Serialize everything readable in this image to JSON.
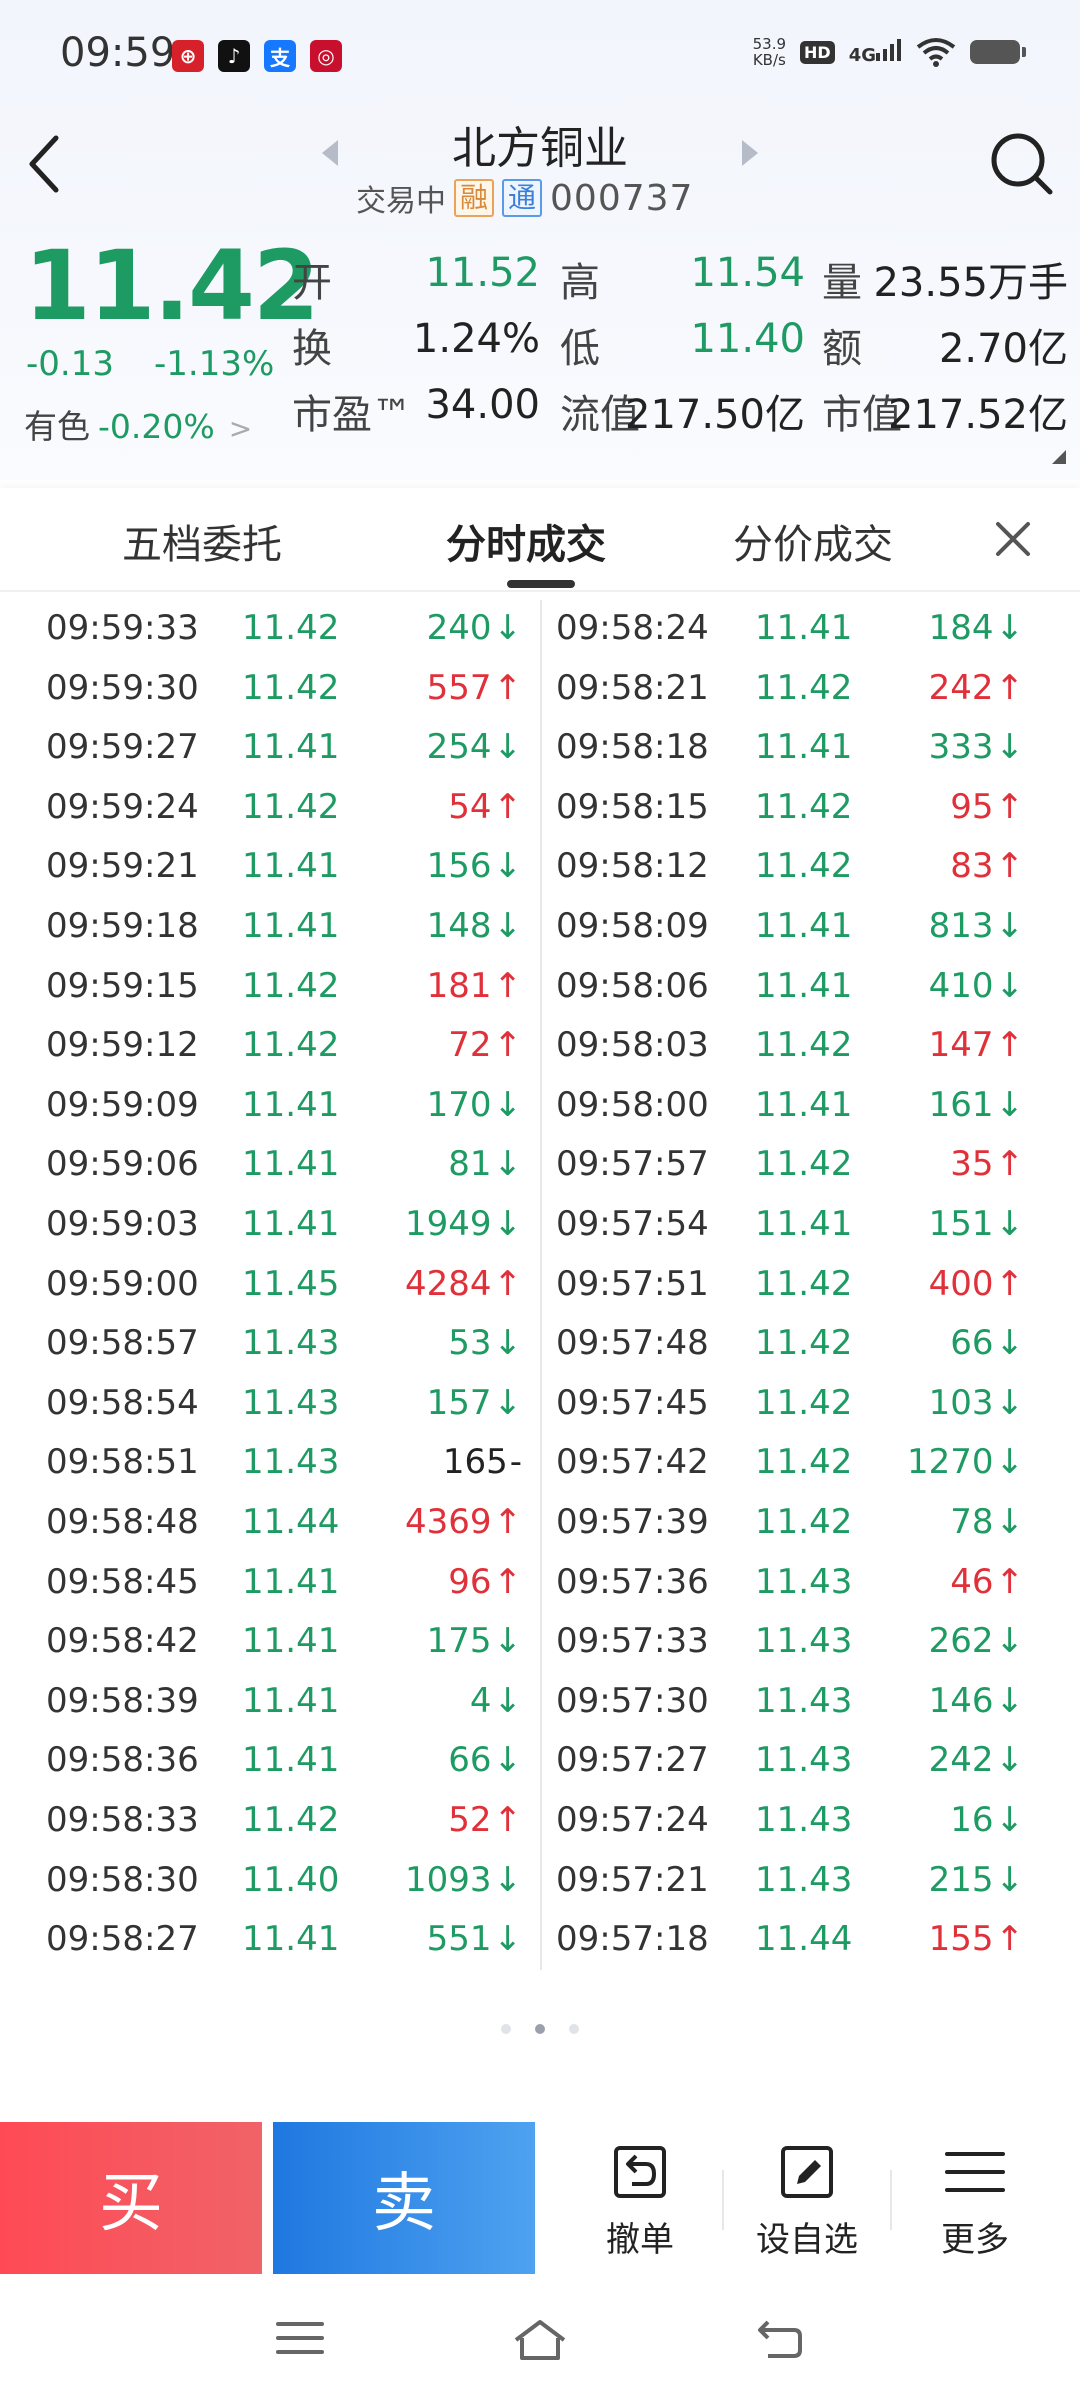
{
  "status_bar": {
    "time": "09:59",
    "net_speed_value": "53.9",
    "net_speed_unit": "KB/s",
    "hd": "HD",
    "network": "4G",
    "apps": [
      {
        "name": "bank-app-icon",
        "glyph": "⊕",
        "color": "#d6212b"
      },
      {
        "name": "tiktok-app-icon",
        "glyph": "♪",
        "color": "#111111"
      },
      {
        "name": "alipay-app-icon",
        "glyph": "支",
        "color": "#1677ff"
      },
      {
        "name": "china-bank-app-icon",
        "glyph": "◎",
        "color": "#c8102e"
      }
    ]
  },
  "header": {
    "title": "北方铜业",
    "status": "交易中",
    "tag_rong": "融",
    "tag_tong": "通",
    "code": "000737"
  },
  "quote": {
    "price": "11.42",
    "change": "-0.13",
    "change_pct": "-1.13%",
    "sector_label": "有色",
    "sector_change": "-0.20%",
    "sector_arrow": ">",
    "open_label": "开",
    "open": "11.52",
    "high_label": "高",
    "high": "11.54",
    "volume_label": "量",
    "volume": "23.55万手",
    "turnover_label": "换",
    "turnover": "1.24%",
    "low_label": "低",
    "low": "11.40",
    "amount_label": "额",
    "amount": "2.70亿",
    "pe_label": "市盈™",
    "pe": "34.00",
    "float_cap_label": "流值",
    "float_cap": "217.50亿",
    "total_cap_label": "市值",
    "total_cap": "217.52亿"
  },
  "tabs": [
    {
      "label": "五档委托",
      "active": false
    },
    {
      "label": "分时成交",
      "active": true
    },
    {
      "label": "分价成交",
      "active": false
    }
  ],
  "trades_left": [
    {
      "time": "09:59:33",
      "price": "11.42",
      "volume": "240",
      "dir": "down"
    },
    {
      "time": "09:59:30",
      "price": "11.42",
      "volume": "557",
      "dir": "up"
    },
    {
      "time": "09:59:27",
      "price": "11.41",
      "volume": "254",
      "dir": "down"
    },
    {
      "time": "09:59:24",
      "price": "11.42",
      "volume": "54",
      "dir": "up"
    },
    {
      "time": "09:59:21",
      "price": "11.41",
      "volume": "156",
      "dir": "down"
    },
    {
      "time": "09:59:18",
      "price": "11.41",
      "volume": "148",
      "dir": "down"
    },
    {
      "time": "09:59:15",
      "price": "11.42",
      "volume": "181",
      "dir": "up"
    },
    {
      "time": "09:59:12",
      "price": "11.42",
      "volume": "72",
      "dir": "up"
    },
    {
      "time": "09:59:09",
      "price": "11.41",
      "volume": "170",
      "dir": "down"
    },
    {
      "time": "09:59:06",
      "price": "11.41",
      "volume": "81",
      "dir": "down"
    },
    {
      "time": "09:59:03",
      "price": "11.41",
      "volume": "1949",
      "dir": "down"
    },
    {
      "time": "09:59:00",
      "price": "11.45",
      "volume": "4284",
      "dir": "up"
    },
    {
      "time": "09:58:57",
      "price": "11.43",
      "volume": "53",
      "dir": "down"
    },
    {
      "time": "09:58:54",
      "price": "11.43",
      "volume": "157",
      "dir": "down"
    },
    {
      "time": "09:58:51",
      "price": "11.43",
      "volume": "165",
      "dir": "flat"
    },
    {
      "time": "09:58:48",
      "price": "11.44",
      "volume": "4369",
      "dir": "up"
    },
    {
      "time": "09:58:45",
      "price": "11.41",
      "volume": "96",
      "dir": "up"
    },
    {
      "time": "09:58:42",
      "price": "11.41",
      "volume": "175",
      "dir": "down"
    },
    {
      "time": "09:58:39",
      "price": "11.41",
      "volume": "4",
      "dir": "down"
    },
    {
      "time": "09:58:36",
      "price": "11.41",
      "volume": "66",
      "dir": "down"
    },
    {
      "time": "09:58:33",
      "price": "11.42",
      "volume": "52",
      "dir": "up"
    },
    {
      "time": "09:58:30",
      "price": "11.40",
      "volume": "1093",
      "dir": "down"
    },
    {
      "time": "09:58:27",
      "price": "11.41",
      "volume": "551",
      "dir": "down"
    }
  ],
  "trades_right": [
    {
      "time": "09:58:24",
      "price": "11.41",
      "volume": "184",
      "dir": "down"
    },
    {
      "time": "09:58:21",
      "price": "11.42",
      "volume": "242",
      "dir": "up"
    },
    {
      "time": "09:58:18",
      "price": "11.41",
      "volume": "333",
      "dir": "down"
    },
    {
      "time": "09:58:15",
      "price": "11.42",
      "volume": "95",
      "dir": "up"
    },
    {
      "time": "09:58:12",
      "price": "11.42",
      "volume": "83",
      "dir": "up"
    },
    {
      "time": "09:58:09",
      "price": "11.41",
      "volume": "813",
      "dir": "down"
    },
    {
      "time": "09:58:06",
      "price": "11.41",
      "volume": "410",
      "dir": "down"
    },
    {
      "time": "09:58:03",
      "price": "11.42",
      "volume": "147",
      "dir": "up"
    },
    {
      "time": "09:58:00",
      "price": "11.41",
      "volume": "161",
      "dir": "down"
    },
    {
      "time": "09:57:57",
      "price": "11.42",
      "volume": "35",
      "dir": "up"
    },
    {
      "time": "09:57:54",
      "price": "11.41",
      "volume": "151",
      "dir": "down"
    },
    {
      "time": "09:57:51",
      "price": "11.42",
      "volume": "400",
      "dir": "up"
    },
    {
      "time": "09:57:48",
      "price": "11.42",
      "volume": "66",
      "dir": "down"
    },
    {
      "time": "09:57:45",
      "price": "11.42",
      "volume": "103",
      "dir": "down"
    },
    {
      "time": "09:57:42",
      "price": "11.42",
      "volume": "1270",
      "dir": "down"
    },
    {
      "time": "09:57:39",
      "price": "11.42",
      "volume": "78",
      "dir": "down"
    },
    {
      "time": "09:57:36",
      "price": "11.43",
      "volume": "46",
      "dir": "up"
    },
    {
      "time": "09:57:33",
      "price": "11.43",
      "volume": "262",
      "dir": "down"
    },
    {
      "time": "09:57:30",
      "price": "11.43",
      "volume": "146",
      "dir": "down"
    },
    {
      "time": "09:57:27",
      "price": "11.43",
      "volume": "242",
      "dir": "down"
    },
    {
      "time": "09:57:24",
      "price": "11.43",
      "volume": "16",
      "dir": "down"
    },
    {
      "time": "09:57:21",
      "price": "11.43",
      "volume": "215",
      "dir": "down"
    },
    {
      "time": "09:57:18",
      "price": "11.44",
      "volume": "155",
      "dir": "up"
    }
  ],
  "bottom": {
    "buy": "买",
    "sell": "卖",
    "cancel": "撤单",
    "add_watch": "设自选",
    "more": "更多"
  },
  "colors": {
    "down_green": "#1e9a63",
    "up_red": "#e0303a",
    "buy_red": "#ff4a55",
    "sell_blue": "#1f78e0"
  }
}
